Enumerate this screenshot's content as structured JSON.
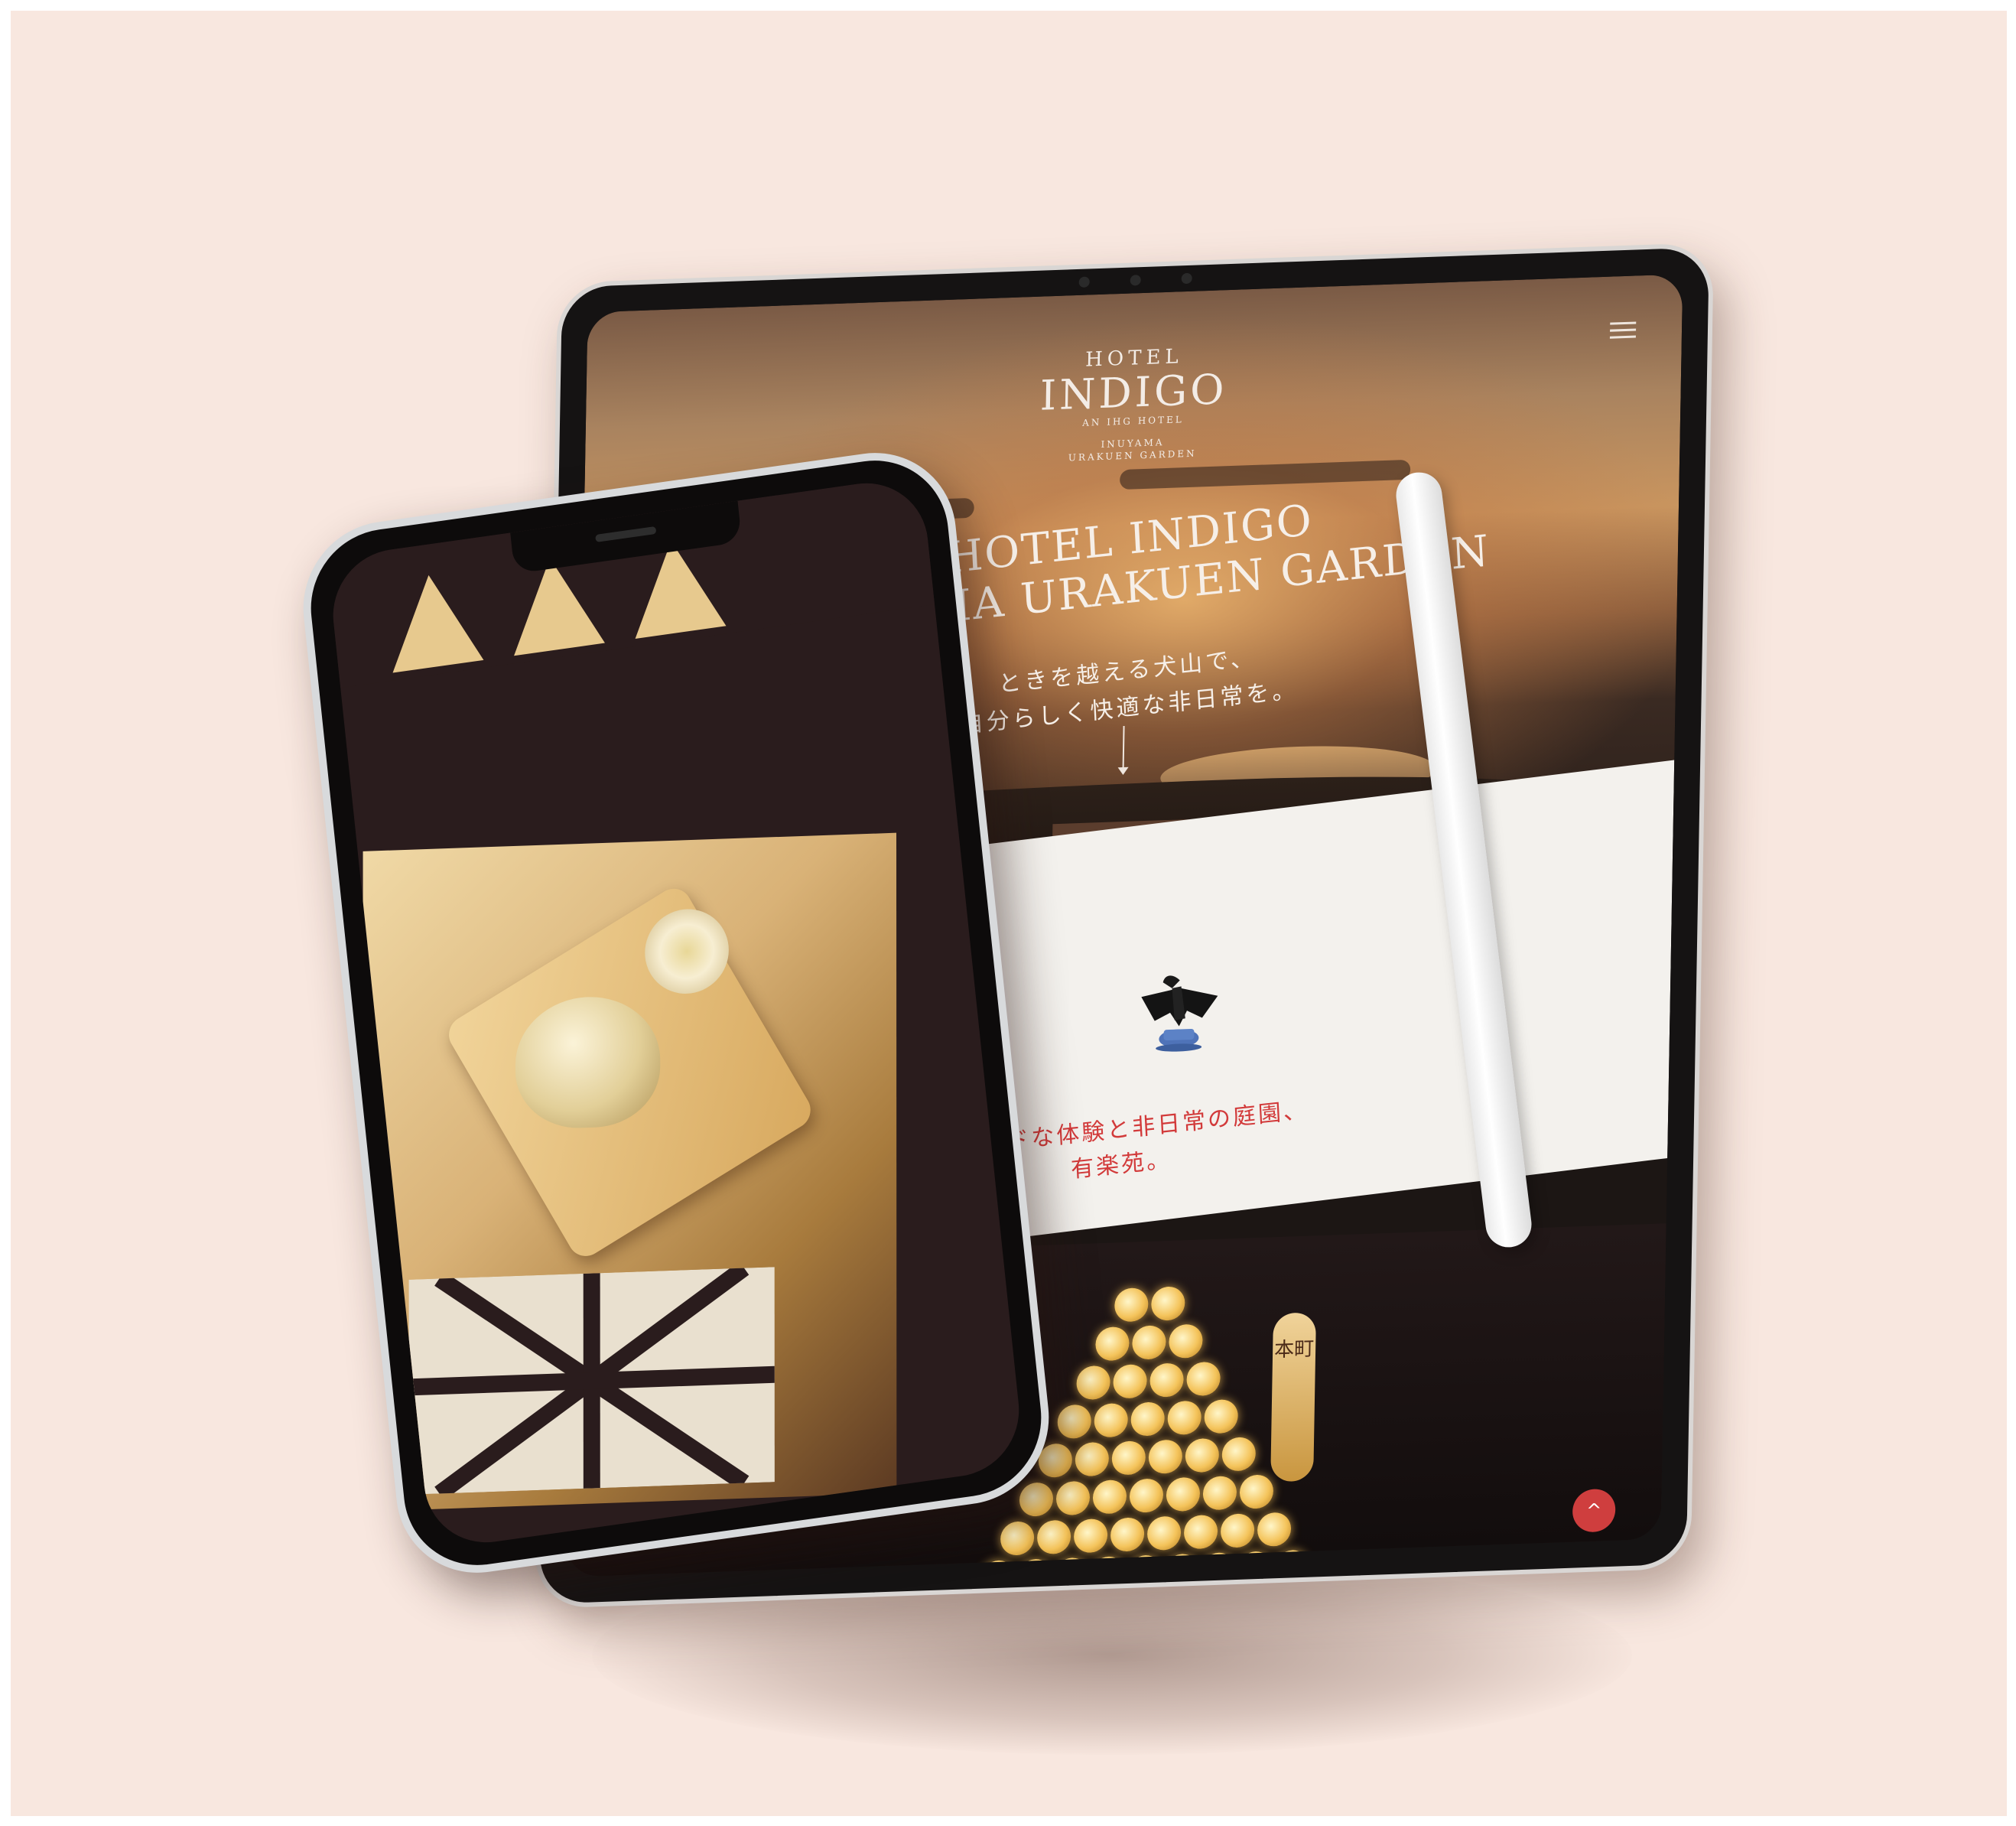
{
  "tablet": {
    "logo": {
      "line1": "HOTEL",
      "line2": "INDIGO",
      "line3": "AN IHG HOTEL",
      "line4": "INUYAMA",
      "line5": "URAKUEN GARDEN"
    },
    "hero": {
      "title_line1": "HOTEL INDIGO",
      "title_line2": "INUYAMA URAKUEN GARDEN",
      "copy_line1": "ときを越える犬山で、",
      "copy_line2": "自分らしく快適な非日常を。"
    },
    "section2": {
      "tagline_line1": "ビビッドな体験と非日常の庭園、",
      "tagline_line2": "有楽苑。"
    },
    "lantern_sign": "本町",
    "back_to_top_symbol": "^"
  },
  "icons": {
    "menu": "hamburger-menu-icon",
    "scroll": "down-arrow-icon",
    "top": "chevron-up-icon"
  },
  "colors": {
    "background": "#f8e7df",
    "accent_red": "#d23a3a",
    "device_dark": "#151313"
  }
}
